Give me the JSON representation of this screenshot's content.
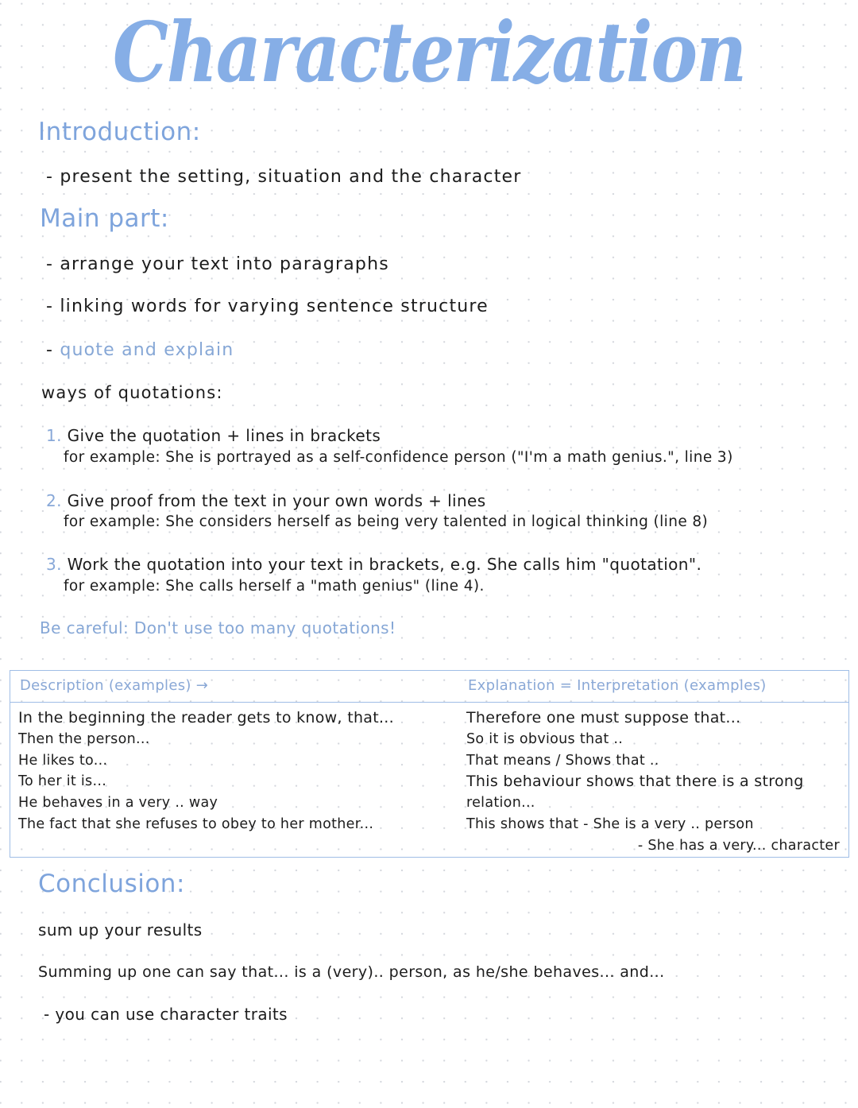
{
  "title": "Characterization",
  "introduction": {
    "heading": "Introduction:",
    "points": [
      "- present the setting, situation and the character"
    ]
  },
  "main_part": {
    "heading": "Main part:",
    "points": [
      "- arrange your text into paragraphs",
      "- linking words for varying sentence structure"
    ],
    "highlight_point_dash": "-",
    "highlight_point": "quote and explain",
    "ways_heading": "ways of quotations:",
    "ways": [
      {
        "number": "1.",
        "text": "Give the quotation + lines in brackets",
        "example": "for example: She is portrayed as a self-confidence person (\"I'm a math genius.\", line 3)"
      },
      {
        "number": "2.",
        "text": "Give proof from the text in your own words + lines",
        "example": "for example: She considers herself as being very talented in logical thinking (line 8)"
      },
      {
        "number": "3.",
        "text": "Work the quotation into your text in brackets, e.g. She calls him \"quotation\".",
        "example": "for example: She calls herself a \"math genius\" (line 4)."
      }
    ],
    "warning": "Be careful: Don't use too many quotations!"
  },
  "table": {
    "description_header": "Description (examples) →",
    "explanation_header": "Explanation = Interpretation (examples)",
    "description_rows": [
      "In the beginning the reader gets to know, that...",
      "Then the person...",
      "He likes to...",
      "To her it is...",
      "He behaves in a very .. way",
      "The fact that she refuses to obey to her mother..."
    ],
    "explanation_rows": [
      "Therefore one must suppose that...",
      "So it is obvious that ..",
      "That means / Shows that ..",
      "This behaviour shows that there is a strong",
      "relation...",
      "This shows that - She is a very .. person",
      "- She has a very... character"
    ]
  },
  "conclusion": {
    "heading": "Conclusion:",
    "points": [
      "sum up your results",
      "Summing up one can say that... is a (very).. person, as he/she behaves... and...",
      "- you can use character traits"
    ]
  },
  "colors": {
    "accent_blue": "#7ea4dc",
    "light_blue": "#86a7d6",
    "table_border": "#9fbde6",
    "ink": "#1c1c1c"
  }
}
